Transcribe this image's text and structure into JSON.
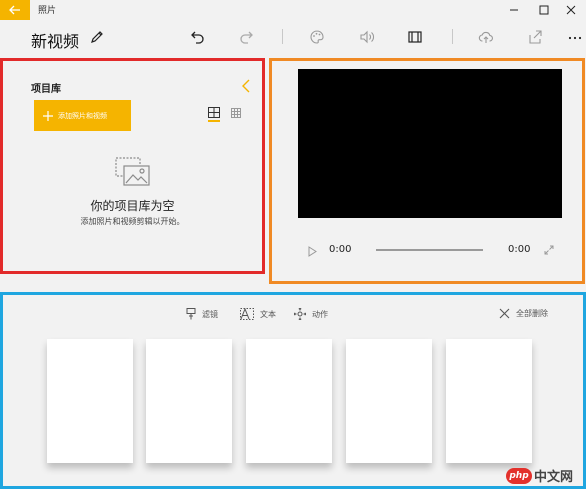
{
  "titlebar": {
    "app_name": "照片"
  },
  "toolbar": {
    "project_title": "新视频"
  },
  "library": {
    "title": "项目库",
    "add_button_label": "添加照片和视频",
    "empty_title": "你的项目库为空",
    "empty_subtitle": "添加照片和视频剪辑以开始。"
  },
  "player": {
    "time_start": "0:00",
    "time_end": "0:00"
  },
  "storyboard": {
    "tools": [
      {
        "label": "滤镜",
        "icon": "filter-icon"
      },
      {
        "label": "文本",
        "icon": "text-icon"
      },
      {
        "label": "动作",
        "icon": "motion-icon"
      }
    ],
    "remove_all_label": "全部删除"
  },
  "watermark": {
    "logo_text": "php",
    "text": "中文网"
  },
  "colors": {
    "accent": "#f5b400",
    "library_border": "#e22a2a",
    "preview_border": "#f08a24",
    "storyboard_border": "#1fa6e0"
  }
}
